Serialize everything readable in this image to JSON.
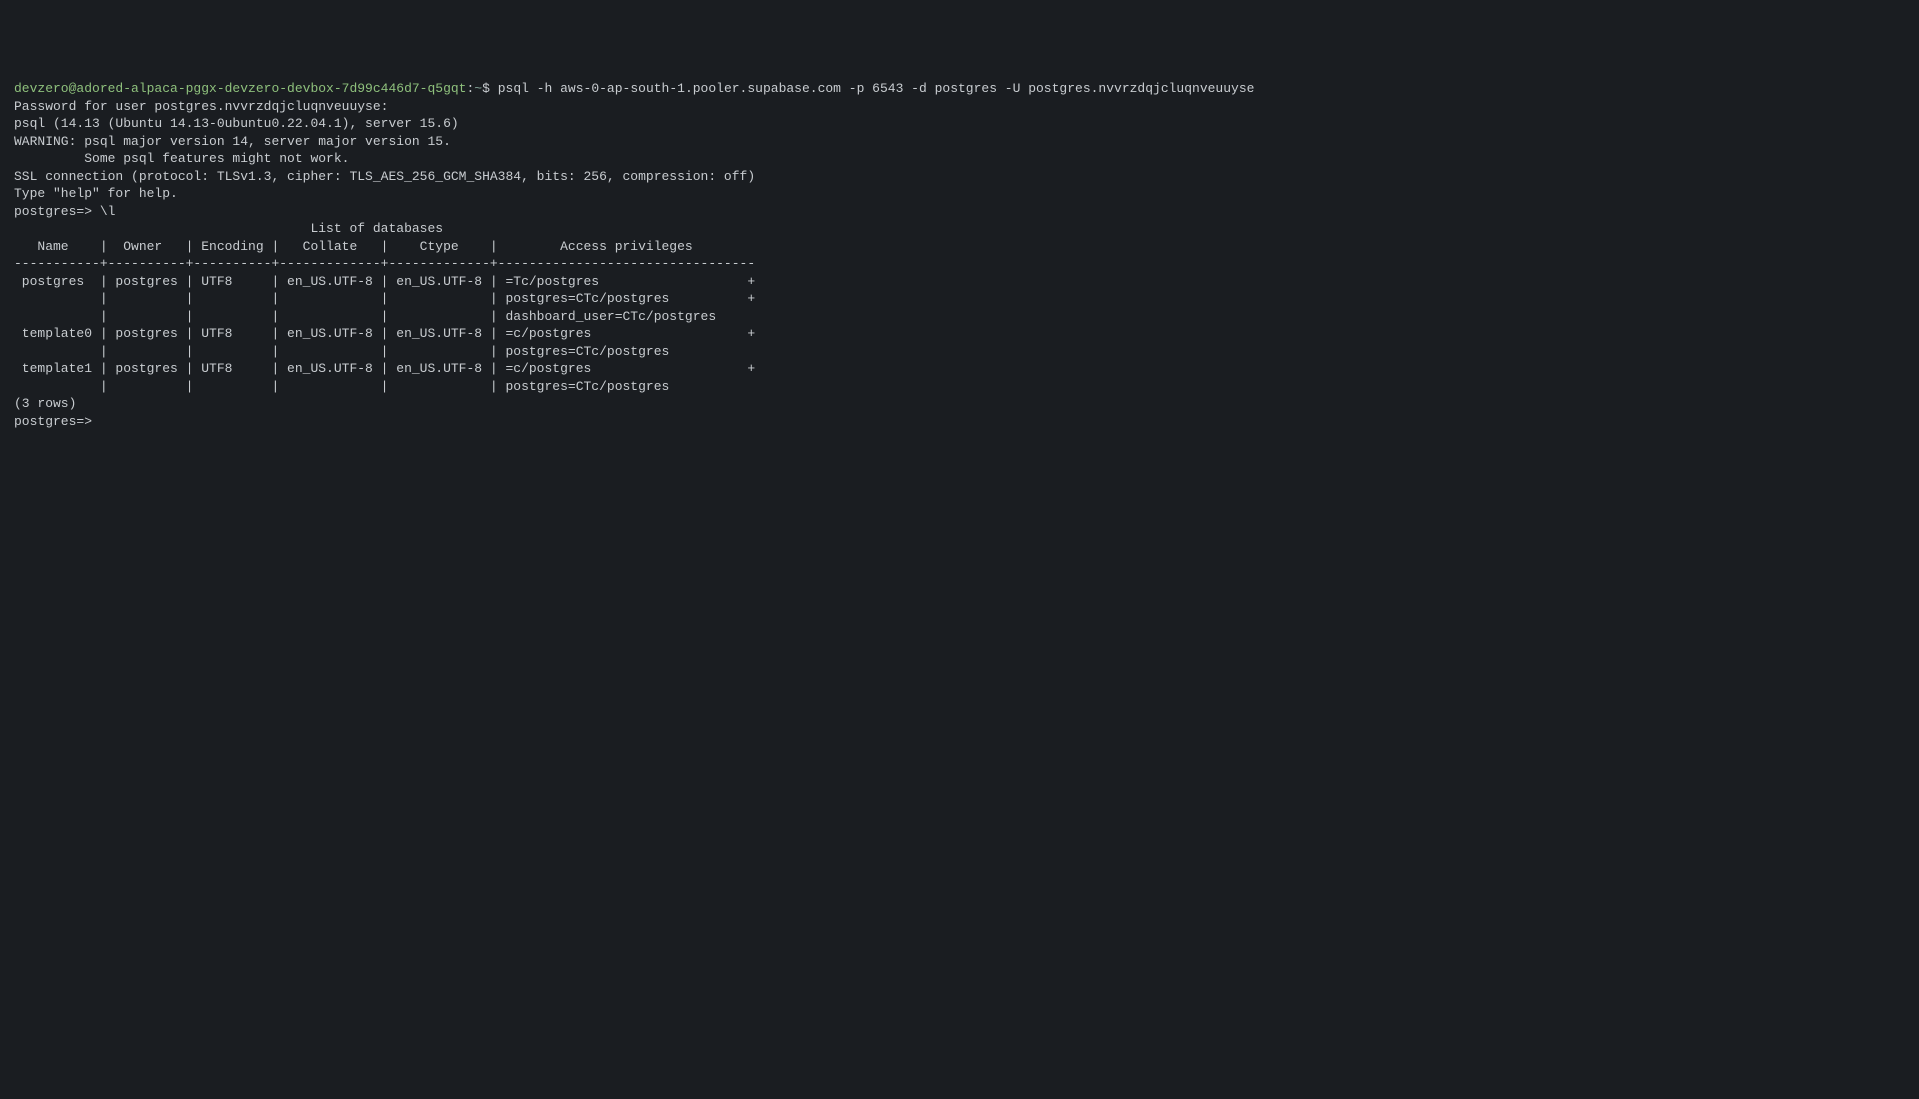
{
  "prompt1": {
    "user_host": "devzero@adored-alpaca-pggx-devzero-devbox-7d99c446d7-q5gqt",
    "sep1": ":",
    "path": "~",
    "sep2": "$ ",
    "command": "psql -h aws-0-ap-south-1.pooler.supabase.com -p 6543 -d postgres -U postgres.nvvrzdqjcluqnveuuyse"
  },
  "lines": {
    "l1": "Password for user postgres.nvvrzdqjcluqnveuuyse:",
    "l2": "psql (14.13 (Ubuntu 14.13-0ubuntu0.22.04.1), server 15.6)",
    "l3": "WARNING: psql major version 14, server major version 15.",
    "l4": "         Some psql features might not work.",
    "l5": "SSL connection (protocol: TLSv1.3, cipher: TLS_AES_256_GCM_SHA384, bits: 256, compression: off)",
    "l6": "Type \"help\" for help.",
    "l7": "",
    "l8": "postgres=> \\l",
    "l9": "                                      List of databases",
    "l10": "   Name    |  Owner   | Encoding |   Collate   |    Ctype    |        Access privileges        ",
    "l11": "-----------+----------+----------+-------------+-------------+---------------------------------",
    "l12": " postgres  | postgres | UTF8     | en_US.UTF-8 | en_US.UTF-8 | =Tc/postgres                   +",
    "l13": "           |          |          |             |             | postgres=CTc/postgres          +",
    "l14": "           |          |          |             |             | dashboard_user=CTc/postgres",
    "l15": " template0 | postgres | UTF8     | en_US.UTF-8 | en_US.UTF-8 | =c/postgres                    +",
    "l16": "           |          |          |             |             | postgres=CTc/postgres",
    "l17": " template1 | postgres | UTF8     | en_US.UTF-8 | en_US.UTF-8 | =c/postgres                    +",
    "l18": "           |          |          |             |             | postgres=CTc/postgres",
    "l19": "(3 rows)",
    "l20": "",
    "l21": "postgres=> "
  }
}
